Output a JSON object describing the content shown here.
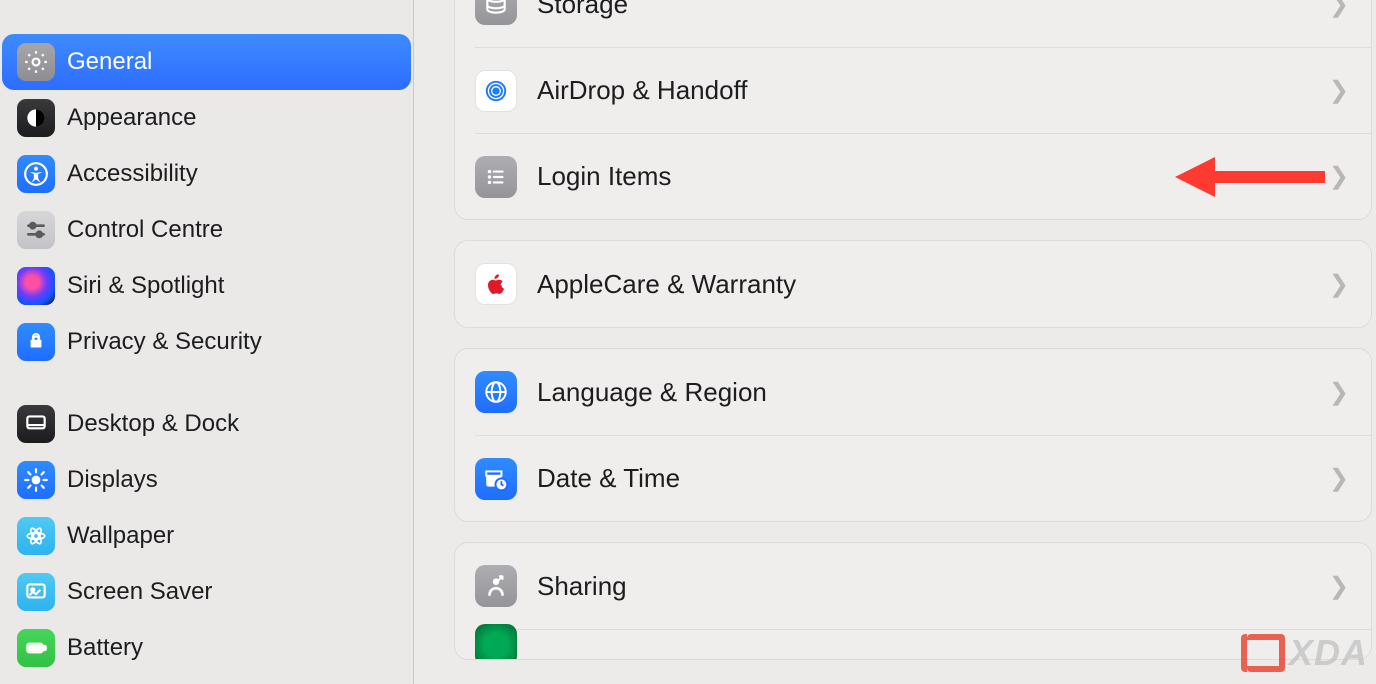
{
  "sidebar": {
    "items": [
      {
        "label": "General",
        "icon": "gear-icon",
        "selected": true
      },
      {
        "label": "Appearance",
        "icon": "appearance-icon",
        "selected": false
      },
      {
        "label": "Accessibility",
        "icon": "accessibility-icon",
        "selected": false
      },
      {
        "label": "Control Centre",
        "icon": "control-centre-icon",
        "selected": false
      },
      {
        "label": "Siri & Spotlight",
        "icon": "siri-icon",
        "selected": false
      },
      {
        "label": "Privacy & Security",
        "icon": "privacy-icon",
        "selected": false
      },
      {
        "label": "Desktop & Dock",
        "icon": "desktop-dock-icon",
        "selected": false
      },
      {
        "label": "Displays",
        "icon": "displays-icon",
        "selected": false
      },
      {
        "label": "Wallpaper",
        "icon": "wallpaper-icon",
        "selected": false
      },
      {
        "label": "Screen Saver",
        "icon": "screen-saver-icon",
        "selected": false
      },
      {
        "label": "Battery",
        "icon": "battery-icon",
        "selected": false
      }
    ]
  },
  "main": {
    "groups": [
      {
        "rows": [
          {
            "label": "Storage",
            "icon": "storage-icon"
          },
          {
            "label": "AirDrop & Handoff",
            "icon": "airdrop-icon"
          },
          {
            "label": "Login Items",
            "icon": "login-items-icon",
            "annotated": true
          }
        ]
      },
      {
        "rows": [
          {
            "label": "AppleCare & Warranty",
            "icon": "applecare-icon"
          }
        ]
      },
      {
        "rows": [
          {
            "label": "Language & Region",
            "icon": "language-region-icon"
          },
          {
            "label": "Date & Time",
            "icon": "date-time-icon"
          }
        ]
      },
      {
        "rows": [
          {
            "label": "Sharing",
            "icon": "sharing-icon"
          }
        ]
      }
    ]
  },
  "annotation": {
    "type": "red-arrow",
    "target": "Login Items"
  },
  "watermark": "XDA"
}
